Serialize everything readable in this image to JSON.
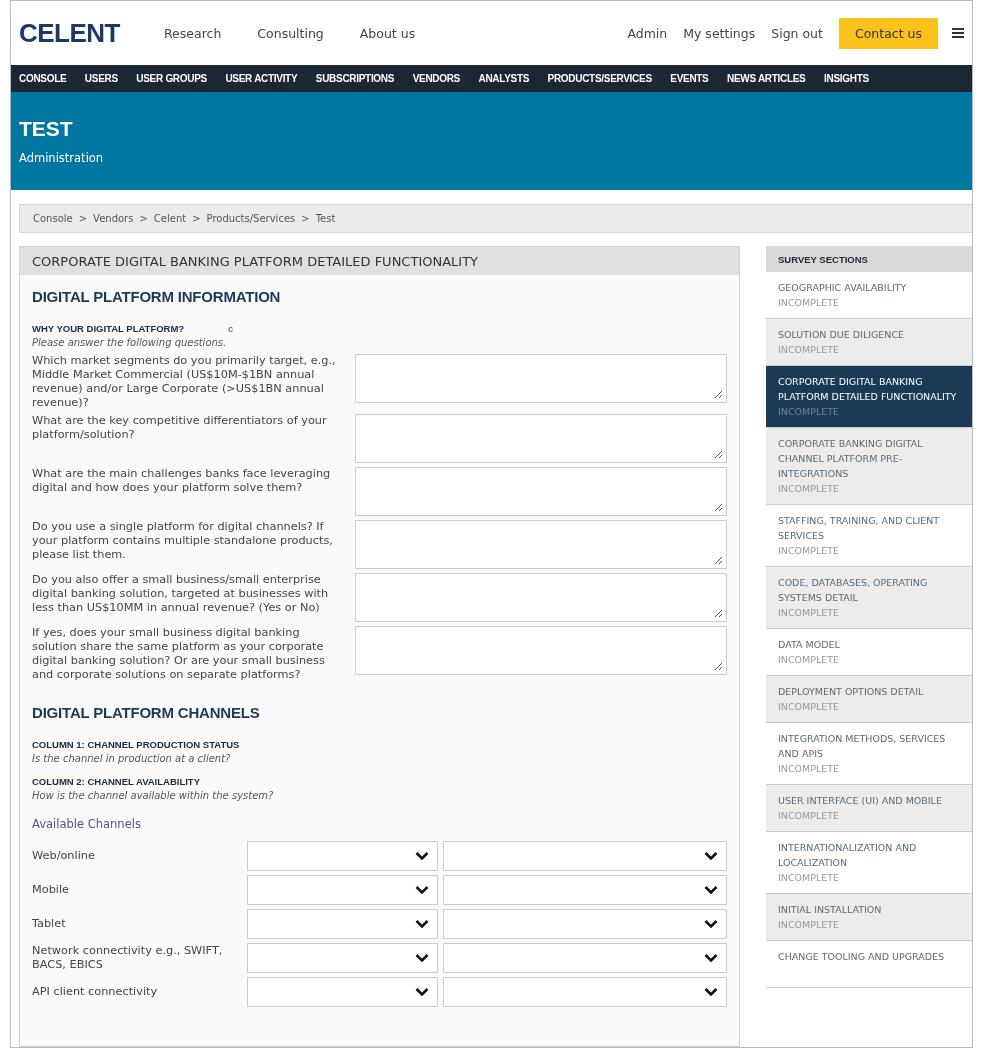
{
  "header": {
    "logo": "CELENT",
    "nav_links": [
      "Research",
      "Consulting",
      "About us"
    ],
    "user_links": [
      "Admin",
      "My settings",
      "Sign out"
    ],
    "contact_button": "Contact us"
  },
  "admin_nav": [
    "CONSOLE",
    "USERS",
    "USER GROUPS",
    "USER ACTIVITY",
    "SUBSCRIPTIONS",
    "VENDORS",
    "ANALYSTS",
    "PRODUCTS/SERVICES",
    "EVENTS",
    "NEWS ARTICLES",
    "INSIGHTS"
  ],
  "banner": {
    "title": "TEST",
    "subtitle": "Administration"
  },
  "breadcrumb": [
    "Console",
    "Vendors",
    "Celent",
    "Products/Services",
    "Test"
  ],
  "breadcrumb_separator": ">",
  "form": {
    "title": "CORPORATE DIGITAL BANKING PLATFORM DETAILED FUNCTIONALITY",
    "information": {
      "heading": "DIGITAL PLATFORM INFORMATION",
      "subheading": "WHY YOUR DIGITAL PLATFORM?",
      "subheading_mark": "c",
      "hint": "Please answer the following questions.",
      "questions": [
        "Which market segments do you primarily target, e.g., Middle Market Commercial (US$10M-$1BN annual revenue) and/or Large Corporate (>US$1BN annual revenue)?",
        "What are the key competitive differentiators of your platform/solution?",
        "What are the main challenges banks face leveraging digital and how does your platform solve them?",
        "Do you use a single platform for digital channels? If your platform contains multiple standalone products, please list them.",
        "Do you also offer a small business/small enterprise digital banking solution, targeted at businesses with less than US$10MM in annual revenue? (Yes or No)",
        "If yes, does your small business digital banking solution share the same platform as your corporate digital banking solution? Or are your small business and corporate solutions on separate platforms?"
      ]
    },
    "channels": {
      "heading": "DIGITAL PLATFORM CHANNELS",
      "columns": [
        {
          "title": "COLUMN 1: CHANNEL PRODUCTION STATUS",
          "hint": "Is the channel in production at a client?"
        },
        {
          "title": "COLUMN 2: CHANNEL AVAILABILITY",
          "hint": "How is the channel available within the system?"
        }
      ],
      "table_label": "Available Channels",
      "rows": [
        "Web/online",
        "Mobile",
        "Tablet",
        "Network connectivity e.g., SWIFT, BACS, EBICS",
        "API client connectivity"
      ]
    }
  },
  "sidebar": {
    "title": "SURVEY SECTIONS",
    "items": [
      {
        "label": "GEOGRAPHIC AVAILABILITY",
        "status": "INCOMPLETE",
        "selected": false
      },
      {
        "label": "SOLUTION DUE DILIGENCE",
        "status": "INCOMPLETE",
        "selected": false
      },
      {
        "label": "CORPORATE DIGITAL BANKING PLATFORM DETAILED FUNCTIONALITY",
        "status": "INCOMPLETE",
        "selected": true
      },
      {
        "label": "CORPORATE BANKING DIGITAL CHANNEL PLATFORM PRE-INTEGRATIONS",
        "status": "INCOMPLETE",
        "selected": false
      },
      {
        "label": "STAFFING, TRAINING, AND CLIENT SERVICES",
        "status": "INCOMPLETE",
        "selected": false
      },
      {
        "label": "CODE, DATABASES, OPERATING SYSTEMS DETAIL",
        "status": "INCOMPLETE",
        "selected": false
      },
      {
        "label": "DATA MODEL",
        "status": "INCOMPLETE",
        "selected": false
      },
      {
        "label": "DEPLOYMENT OPTIONS DETAIL",
        "status": "INCOMPLETE",
        "selected": false
      },
      {
        "label": "INTEGRATION METHODS, SERVICES AND APIS",
        "status": "INCOMPLETE",
        "selected": false
      },
      {
        "label": "USER INTERFACE (UI) AND MOBILE",
        "status": "INCOMPLETE",
        "selected": false
      },
      {
        "label": "INTERNATIONALIZATION AND LOCALIZATION",
        "status": "INCOMPLETE",
        "selected": false
      },
      {
        "label": "INITIAL INSTALLATION",
        "status": "INCOMPLETE",
        "selected": false
      },
      {
        "label": "CHANGE TOOLING AND UPGRADES",
        "selected": false
      }
    ]
  }
}
